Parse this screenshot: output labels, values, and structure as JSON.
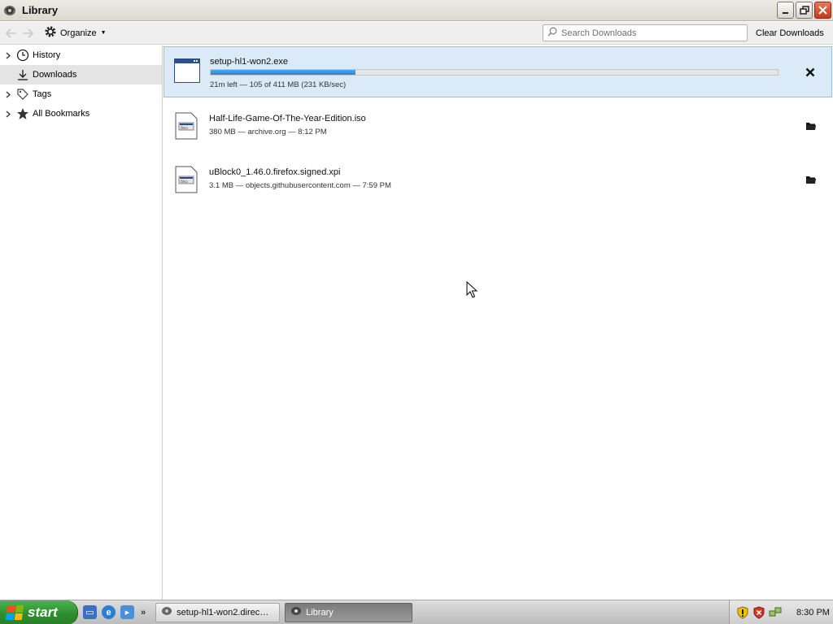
{
  "window": {
    "title": "Library"
  },
  "toolbar": {
    "organize_label": "Organize",
    "search_placeholder": "Search Downloads",
    "clear_label": "Clear Downloads"
  },
  "sidebar": {
    "items": [
      {
        "label": "History",
        "icon": "clock-icon",
        "expandable": true,
        "selected": false
      },
      {
        "label": "Downloads",
        "icon": "download-arrow-icon",
        "expandable": false,
        "selected": true
      },
      {
        "label": "Tags",
        "icon": "tag-icon",
        "expandable": true,
        "selected": false
      },
      {
        "label": "All Bookmarks",
        "icon": "star-icon",
        "expandable": true,
        "selected": false
      }
    ]
  },
  "downloads": [
    {
      "name": "setup-hl1-won2.exe",
      "status": "21m left — 105 of 411 MB (231 KB/sec)",
      "in_progress": true,
      "progress_fraction": 0.255,
      "action": "cancel-icon"
    },
    {
      "name": "Half-Life-Game-Of-The-Year-Edition.iso",
      "status": "380 MB — archive.org — 8:12 PM",
      "in_progress": false,
      "action": "folder-icon"
    },
    {
      "name": "uBlock0_1.46.0.firefox.signed.xpi",
      "status": "3.1 MB — objects.githubusercontent.com — 7:59 PM",
      "in_progress": false,
      "action": "folder-icon"
    }
  ],
  "taskbar": {
    "start_label": "start",
    "tasks": [
      {
        "label": "setup-hl1-won2.direc…",
        "active": false
      },
      {
        "label": "Library",
        "active": true
      }
    ],
    "clock": "8:30 PM"
  },
  "colors": {
    "active_row_bg": "#dbeaf7",
    "progress_fill": "#2a84d6",
    "start_green": "#2d8e2d"
  }
}
